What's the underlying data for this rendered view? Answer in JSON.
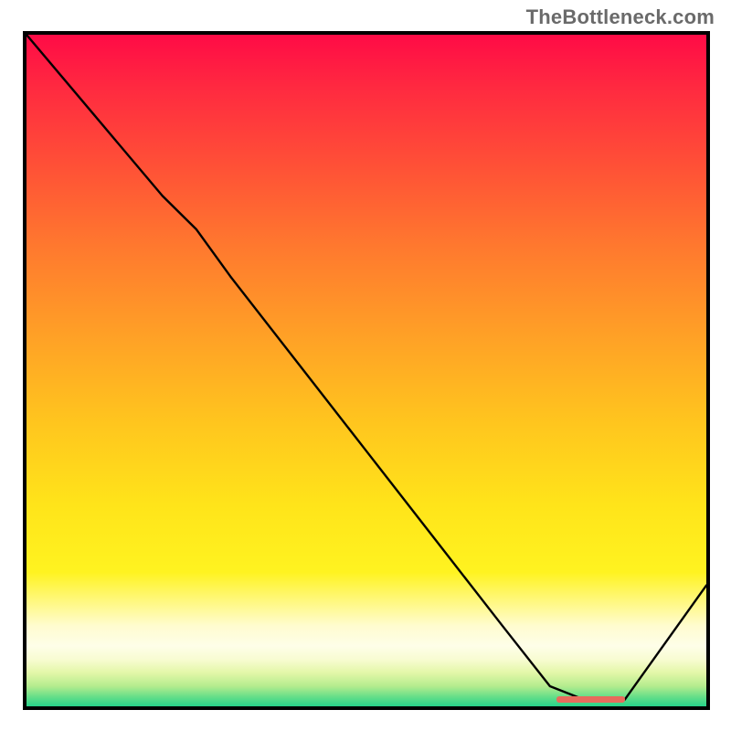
{
  "watermark": "TheBottleneck.com",
  "colors": {
    "frame": "#000000",
    "curve": "#000000",
    "marker": "#e86b5c",
    "gradient_top": "#ff0b46",
    "gradient_mid": "#ffd21a",
    "gradient_low": "#fffccf",
    "gradient_green": "#26d28a"
  },
  "chart_data": {
    "type": "line",
    "title": "",
    "xlabel": "",
    "ylabel": "",
    "xlim": [
      0,
      100
    ],
    "ylim": [
      0,
      100
    ],
    "grid": false,
    "series": [
      {
        "name": "bottleneck-curve",
        "x": [
          0,
          10,
          20,
          25,
          30,
          40,
          50,
          60,
          70,
          77,
          82,
          88,
          100
        ],
        "y": [
          100,
          88,
          76,
          71,
          64,
          51,
          38,
          25,
          12,
          3,
          1,
          1,
          18
        ]
      }
    ],
    "marker": {
      "x_start": 78,
      "x_end": 88,
      "y": 1,
      "color": "#e86b5c"
    },
    "background": {
      "stops": [
        {
          "pos": 0,
          "color": "#ff0b46"
        },
        {
          "pos": 0.45,
          "color": "#ffa126"
        },
        {
          "pos": 0.7,
          "color": "#ffe41a"
        },
        {
          "pos": 0.9,
          "color": "#fefee8"
        },
        {
          "pos": 1.0,
          "color": "#26d28a"
        }
      ]
    }
  }
}
